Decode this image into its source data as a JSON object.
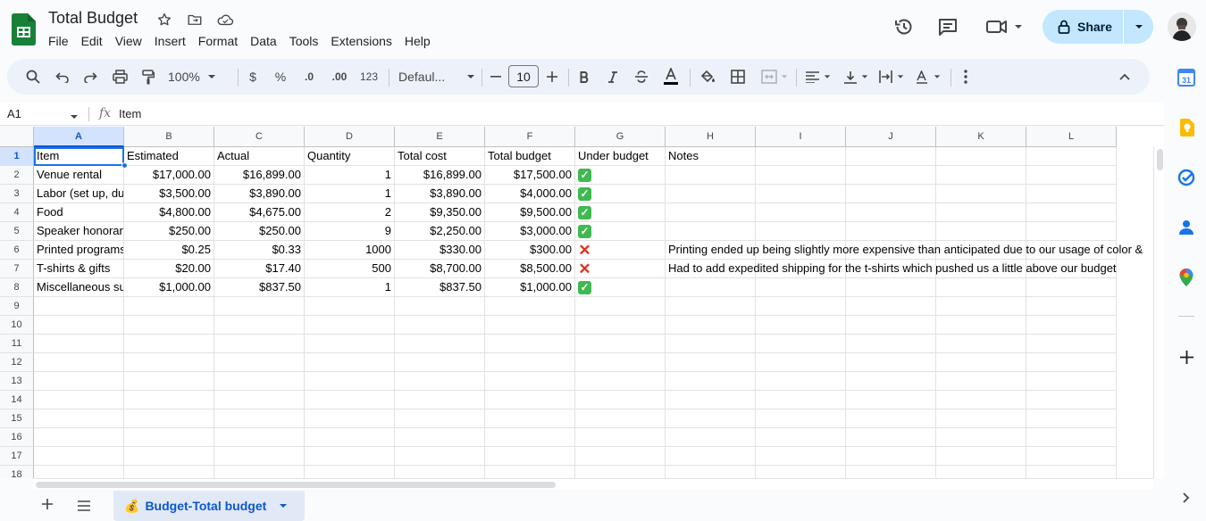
{
  "doc": {
    "title": "Total Budget"
  },
  "menu": [
    "File",
    "Edit",
    "View",
    "Insert",
    "Format",
    "Data",
    "Tools",
    "Extensions",
    "Help"
  ],
  "share": {
    "label": "Share"
  },
  "toolbar": {
    "zoom": "100%",
    "currency": "$",
    "percent": "%",
    "dec_decrease": ".0",
    "dec_increase": ".00",
    "format_more": "123",
    "font": "Defaul...",
    "font_size": "10"
  },
  "formula_bar": {
    "cell_ref": "A1",
    "fx": "fx",
    "value": "Item"
  },
  "grid": {
    "columns": [
      "A",
      "B",
      "C",
      "D",
      "E",
      "F",
      "G",
      "H",
      "I",
      "J",
      "K",
      "L"
    ],
    "row_numbers": [
      "1",
      "2",
      "3",
      "4",
      "5",
      "6",
      "7",
      "8",
      "9",
      "10",
      "11",
      "12",
      "13",
      "14",
      "15",
      "16",
      "17",
      "18"
    ],
    "rows": [
      [
        "Item",
        "Estimated",
        "Actual",
        "Quantity",
        "Total cost",
        "Total budget",
        "Under budget",
        "Notes"
      ],
      [
        "Venue rental",
        "$17,000.00",
        "$16,899.00",
        "1",
        "$16,899.00",
        "$17,500.00",
        "check",
        ""
      ],
      [
        "Labor (set up, du",
        "$3,500.00",
        "$3,890.00",
        "1",
        "$3,890.00",
        "$4,000.00",
        "check",
        ""
      ],
      [
        "Food",
        "$4,800.00",
        "$4,675.00",
        "2",
        "$9,350.00",
        "$9,500.00",
        "check",
        ""
      ],
      [
        "Speaker honorar",
        "$250.00",
        "$250.00",
        "9",
        "$2,250.00",
        "$3,000.00",
        "check",
        ""
      ],
      [
        "Printed programs",
        "$0.25",
        "$0.33",
        "1000",
        "$330.00",
        "$300.00",
        "cross",
        "Printing ended up being slightly more expensive than anticipated due to our usage of color &"
      ],
      [
        "T-shirts & gifts",
        "$20.00",
        "$17.40",
        "500",
        "$8,700.00",
        "$8,500.00",
        "cross",
        "Had to add expedited shipping for the t-shirts which pushed us a little above our budget"
      ],
      [
        "Miscellaneous su",
        "$1,000.00",
        "$837.50",
        "1",
        "$837.50",
        "$1,000.00",
        "check",
        ""
      ]
    ]
  },
  "sheet_tab": {
    "emoji": "💰",
    "label": "Budget-Total budget"
  },
  "side_panel": {
    "calendar_day": "31"
  },
  "colors": {
    "accent": "#0b57d0",
    "share_bg": "#c2e7ff",
    "check": "#3fb950",
    "cross": "#e0301e"
  }
}
